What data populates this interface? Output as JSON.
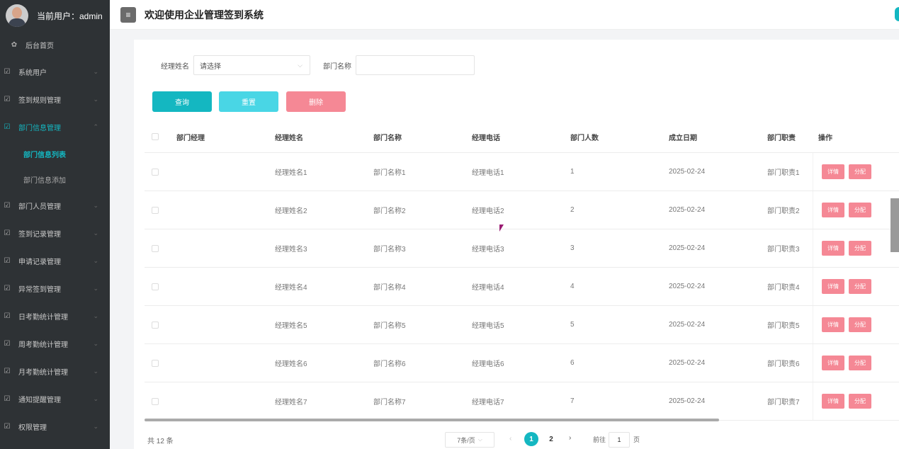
{
  "header": {
    "user_label": "当前用户：admin",
    "title": "欢迎使用企业管理签到系统",
    "menu_toggle_icon": "≡",
    "accent_color": "#14b7c1"
  },
  "sidebar": {
    "home": "后台首页",
    "items": [
      {
        "label": "系统用户",
        "icon": "edit-icon"
      },
      {
        "label": "签到规则管理",
        "icon": "edit-icon"
      },
      {
        "label": "部门信息管理",
        "icon": "edit-icon",
        "expanded": true
      },
      {
        "label": "部门人员管理",
        "icon": "edit-icon"
      },
      {
        "label": "签到记录管理",
        "icon": "edit-icon"
      },
      {
        "label": "申请记录管理",
        "icon": "edit-icon"
      },
      {
        "label": "异常签到管理",
        "icon": "edit-icon"
      },
      {
        "label": "日考勤统计管理",
        "icon": "edit-icon"
      },
      {
        "label": "周考勤统计管理",
        "icon": "edit-icon"
      },
      {
        "label": "月考勤统计管理",
        "icon": "edit-icon"
      },
      {
        "label": "通知提醒管理",
        "icon": "edit-icon"
      },
      {
        "label": "权限管理",
        "icon": "edit-icon"
      }
    ],
    "subitems": [
      {
        "label": "部门信息列表",
        "current": true
      },
      {
        "label": "部门信息添加",
        "current": false
      }
    ]
  },
  "filters": {
    "manager_name_label": "经理姓名",
    "manager_name_value": "请选择",
    "dept_name_label": "部门名称",
    "dept_name_value": ""
  },
  "buttons": {
    "query": "查询",
    "reset": "重置",
    "delete": "删除"
  },
  "table": {
    "headers": [
      "部门经理",
      "经理姓名",
      "部门名称",
      "经理电话",
      "部门人数",
      "成立日期",
      "部门职责",
      "操作"
    ],
    "rows": [
      {
        "manager": "",
        "name": "经理姓名1",
        "dept": "部门名称1",
        "phone": "经理电话1",
        "count": "1",
        "date": "2025-02-24",
        "duty": "部门职责1",
        "detail": "详情",
        "assign": "分配"
      },
      {
        "manager": "",
        "name": "经理姓名2",
        "dept": "部门名称2",
        "phone": "经理电话2",
        "count": "2",
        "date": "2025-02-24",
        "duty": "部门职责2",
        "detail": "详情",
        "assign": "分配"
      },
      {
        "manager": "",
        "name": "经理姓名3",
        "dept": "部门名称3",
        "phone": "经理电话3",
        "count": "3",
        "date": "2025-02-24",
        "duty": "部门职责3",
        "detail": "详情",
        "assign": "分配"
      },
      {
        "manager": "",
        "name": "经理姓名4",
        "dept": "部门名称4",
        "phone": "经理电话4",
        "count": "4",
        "date": "2025-02-24",
        "duty": "部门职责4",
        "detail": "详情",
        "assign": "分配"
      },
      {
        "manager": "",
        "name": "经理姓名5",
        "dept": "部门名称5",
        "phone": "经理电话5",
        "count": "5",
        "date": "2025-02-24",
        "duty": "部门职责5",
        "detail": "详情",
        "assign": "分配"
      },
      {
        "manager": "",
        "name": "经理姓名6",
        "dept": "部门名称6",
        "phone": "经理电话6",
        "count": "6",
        "date": "2025-02-24",
        "duty": "部门职责6",
        "detail": "详情",
        "assign": "分配"
      },
      {
        "manager": "",
        "name": "经理姓名7",
        "dept": "部门名称7",
        "phone": "经理电话7",
        "count": "7",
        "date": "2025-02-24",
        "duty": "部门职责7",
        "detail": "详情",
        "assign": "分配"
      }
    ]
  },
  "pagination": {
    "total": "共 12 条",
    "page_size": "7条/页",
    "prev": "‹",
    "pages": [
      "1",
      "2"
    ],
    "current_page": "1",
    "next": "›",
    "goto_label": "前往",
    "goto_value": "1",
    "goto_suffix": "页"
  }
}
